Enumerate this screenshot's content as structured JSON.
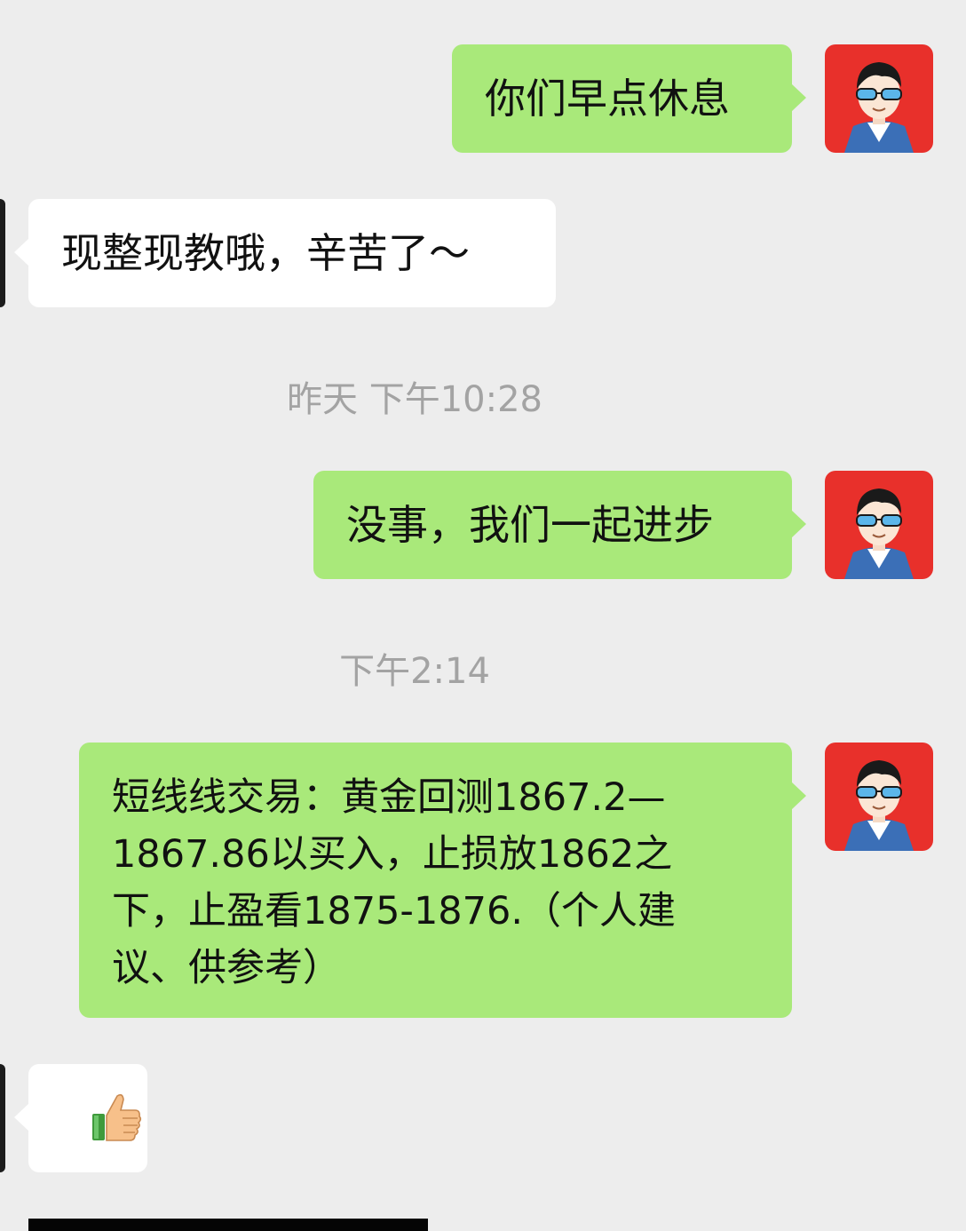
{
  "messages": [
    {
      "side": "out",
      "text": "你们早点休息"
    },
    {
      "side": "in",
      "text": "现整现教哦，辛苦了～"
    },
    {
      "timestamp": "昨天 下午10:28"
    },
    {
      "side": "out",
      "text": "没事，我们一起进步"
    },
    {
      "timestamp": "下午2:14"
    },
    {
      "side": "out",
      "lines": [
        "短线线交易：黄金回测1867.2—",
        "1867.86以买入，止损放1862之",
        "下，止盈看1875-1876.（个人建",
        "议、供参考）"
      ]
    },
    {
      "side": "in",
      "emoji": "thumbs-up-icon"
    }
  ],
  "colors": {
    "background": "#ededed",
    "outgoing_bubble": "#a9e97a",
    "incoming_bubble": "#ffffff",
    "avatar_bg": "#e8302b",
    "timestamp_text": "#a3a3a3"
  }
}
